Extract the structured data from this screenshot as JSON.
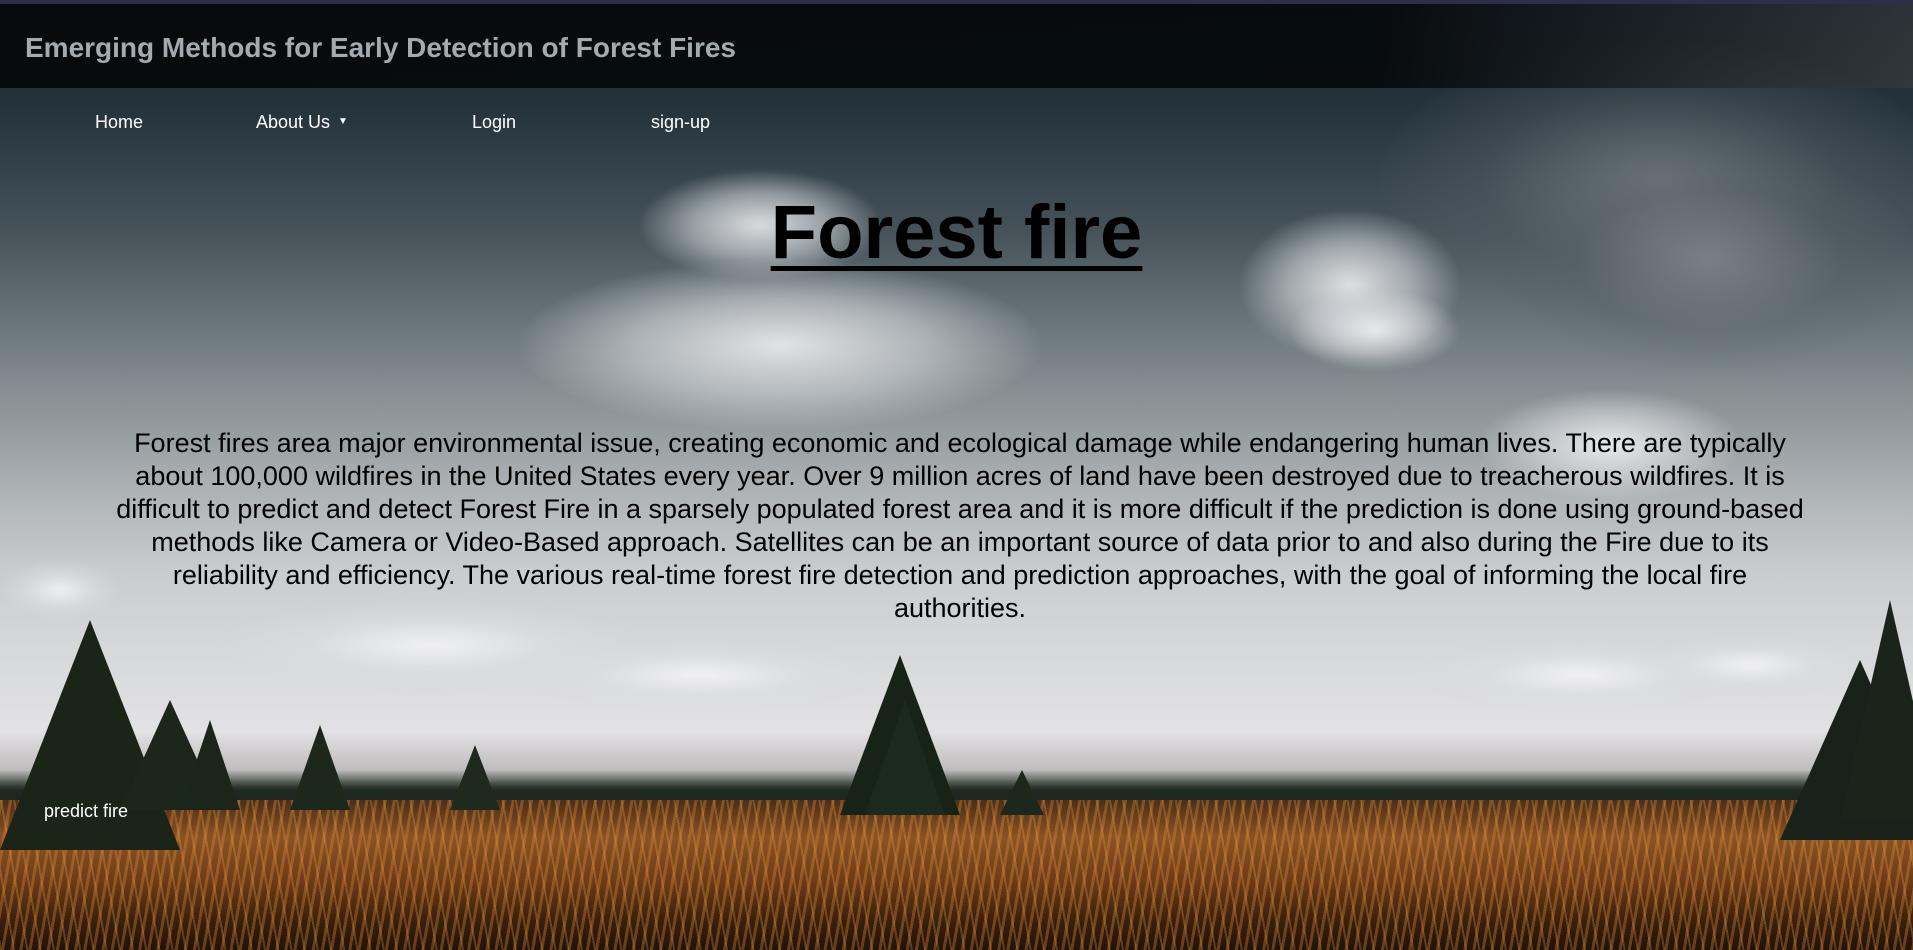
{
  "header": {
    "title": "Emerging Methods for Early Detection of Forest Fires"
  },
  "nav": {
    "home": "Home",
    "about": "About Us",
    "login": "Login",
    "signup": "sign-up"
  },
  "hero": {
    "title": "Forest fire",
    "paragraph": "Forest fires area major environmental issue, creating economic and ecological damage while endangering human lives. There are typically about 100,000 wildfires in the United States every year. Over 9 million acres of land have been destroyed due to treacherous wildfires. It is difficult to predict and detect Forest Fire in a sparsely populated forest area and it is more difficult if the prediction is done using ground-based methods like Camera or Video-Based approach. Satellites can be an important source of data prior to and also during the Fire due to its reliability and efficiency. The various real-time forest fire detection and prediction approaches, with the goal of informing the local fire authorities."
  },
  "actions": {
    "predict": "predict fire"
  },
  "icons": {
    "dropdown": "caret-down-icon"
  },
  "colors": {
    "header_bg": "#060a0d",
    "header_title": "#a3abb1",
    "nav_text": "#ffffff",
    "heading_text": "#000000"
  }
}
